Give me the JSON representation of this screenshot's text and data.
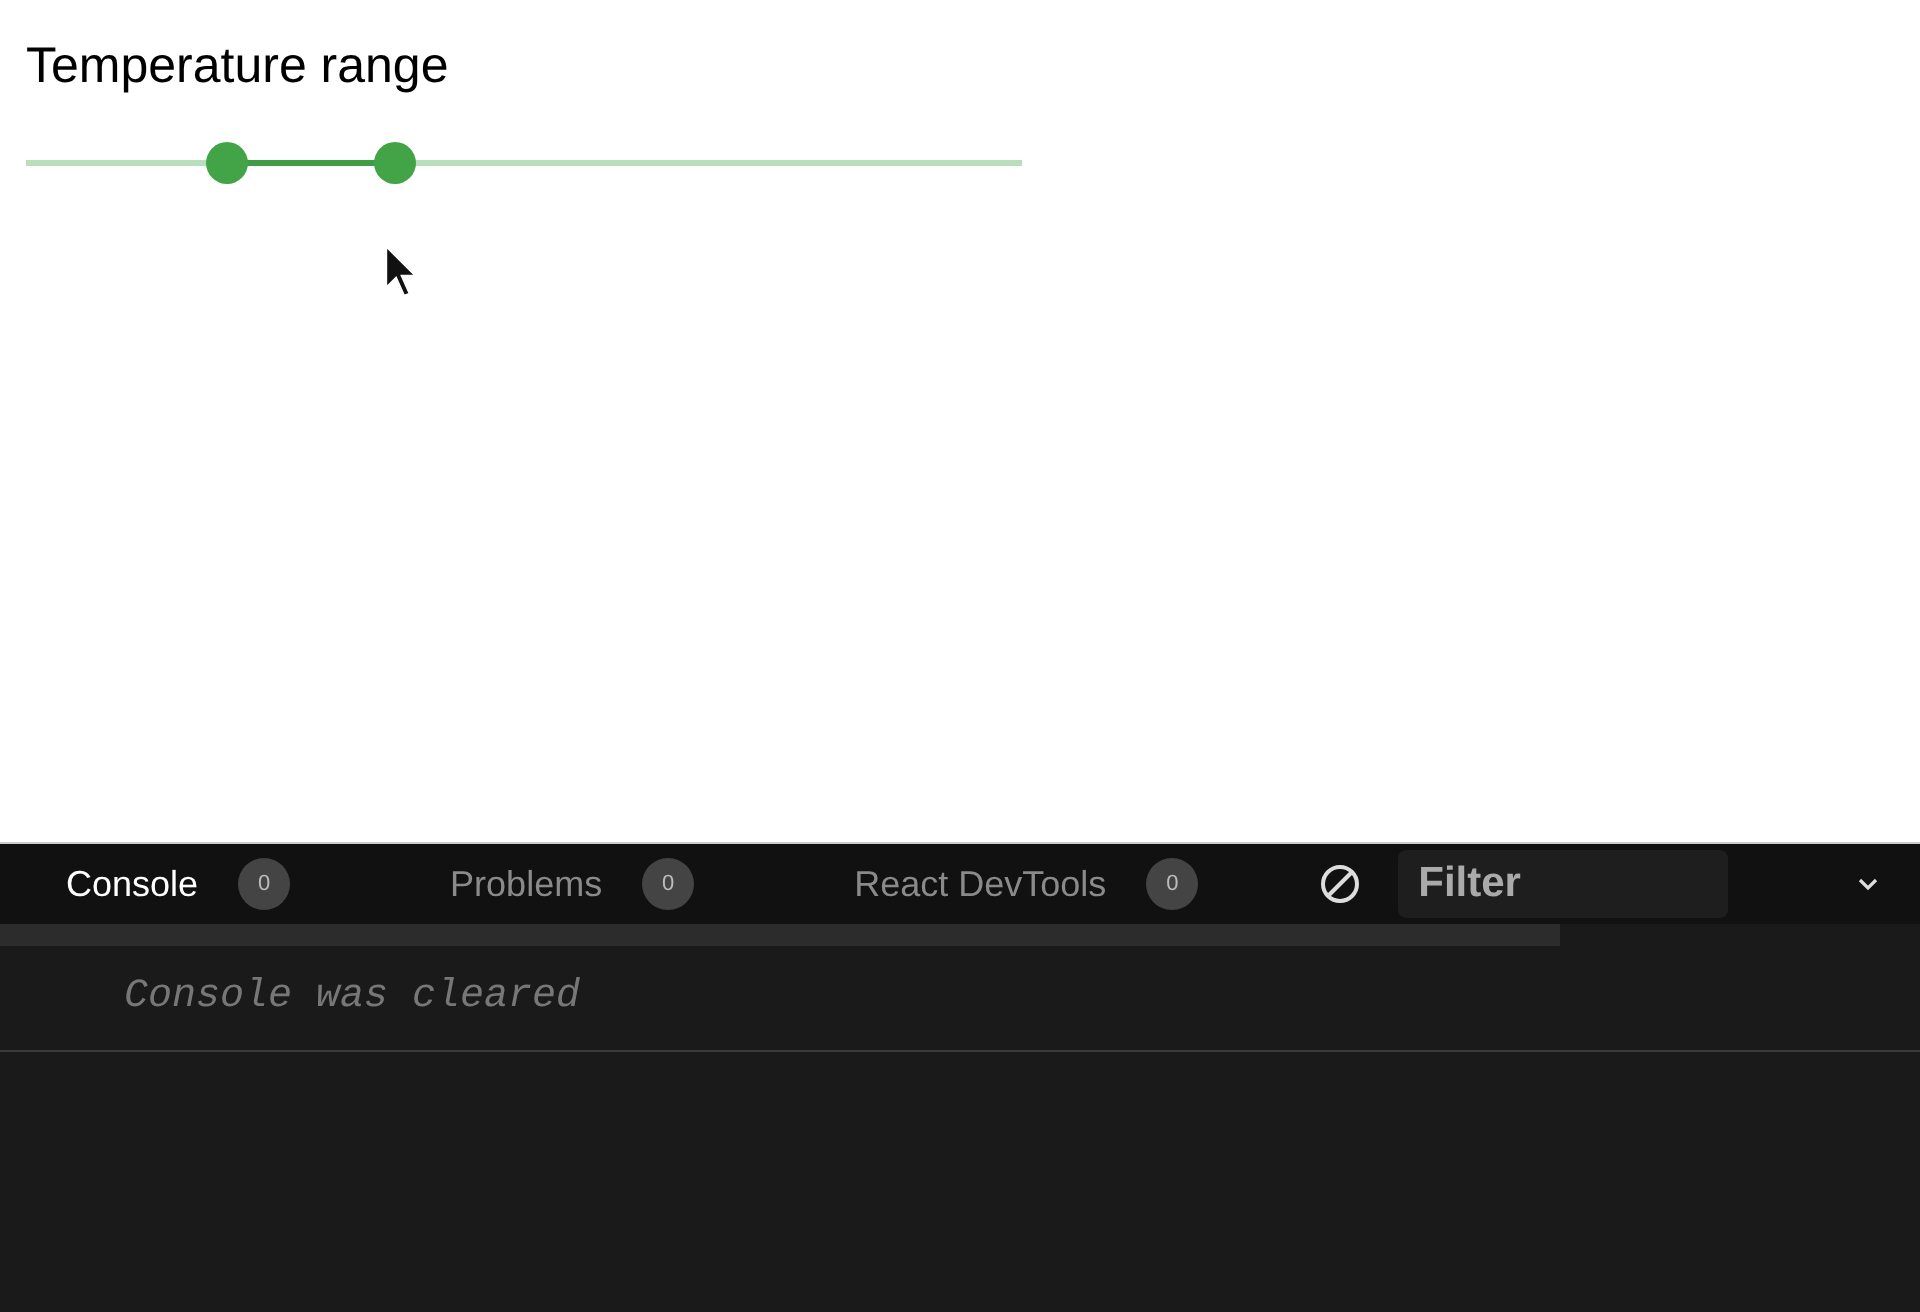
{
  "heading": "Temperature range",
  "slider": {
    "thumbs": [
      {
        "level": 0.2
      },
      {
        "level": 0.37
      }
    ]
  },
  "devtools": {
    "tabs": [
      {
        "label": "Console",
        "count": "0",
        "selected": true
      },
      {
        "label": "Problems",
        "count": "0",
        "selected": false
      },
      {
        "label": "React DevTools",
        "count": "0",
        "selected": false
      }
    ],
    "filter": {
      "placeholder": "Filter"
    },
    "messages": [
      "Console was cleared"
    ]
  }
}
